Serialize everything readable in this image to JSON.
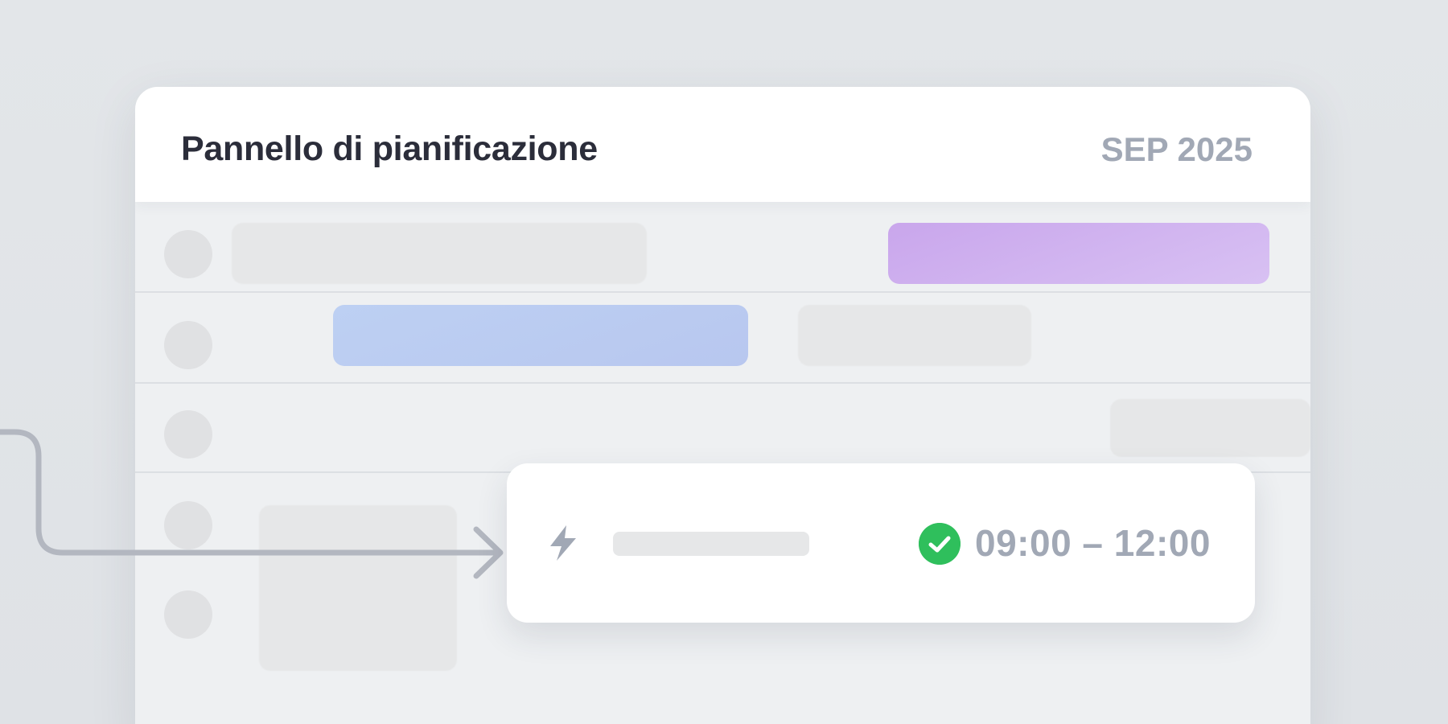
{
  "panel": {
    "title": "Pannello di pianificazione",
    "date": "SEP 2025"
  },
  "event": {
    "time_range": "09:00 – 12:00",
    "status_icon": "check-circle-icon",
    "type_icon": "lightning-bolt-icon"
  },
  "colors": {
    "accent_purple": "#c9a6ec",
    "accent_blue": "#bdd0f3",
    "status_green": "#2fbf5c",
    "muted_text": "#a1a8b5",
    "title_text": "#2b2d3a"
  }
}
